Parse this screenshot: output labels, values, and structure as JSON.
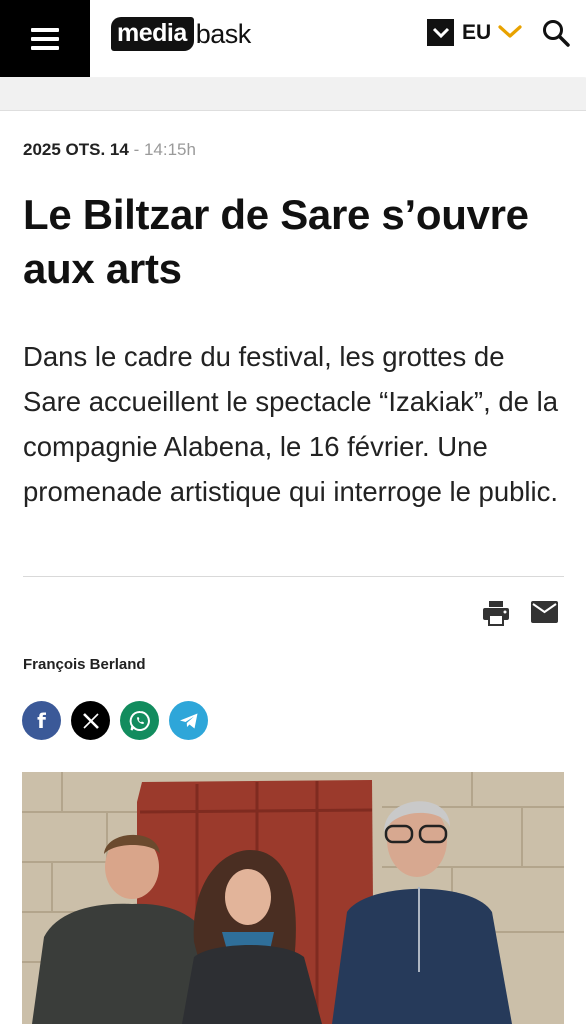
{
  "header": {
    "logo_badge": "media",
    "logo_rest": "bask",
    "language": "EU",
    "accent_color": "#e8a200"
  },
  "article": {
    "date": "2025 OTS. 14",
    "separator": " - ",
    "time": "14:15h",
    "title": "Le Biltzar de Sare s’ouvre aux arts",
    "lead": "Dans le cadre du festival, les grottes de Sare accueillent le spectacle “Izakiak”, de la compagnie Alabena, le 16 février. Une promenade artistique qui interroge le public.",
    "author": "François Berland"
  },
  "tools": {
    "print_icon": "print-icon",
    "mail_icon": "mail-icon"
  },
  "share": {
    "facebook_glyph": "f",
    "colors": {
      "facebook": "#3b5998",
      "x": "#000000",
      "whatsapp": "#128c5e",
      "telegram": "#2ea6d9"
    }
  }
}
